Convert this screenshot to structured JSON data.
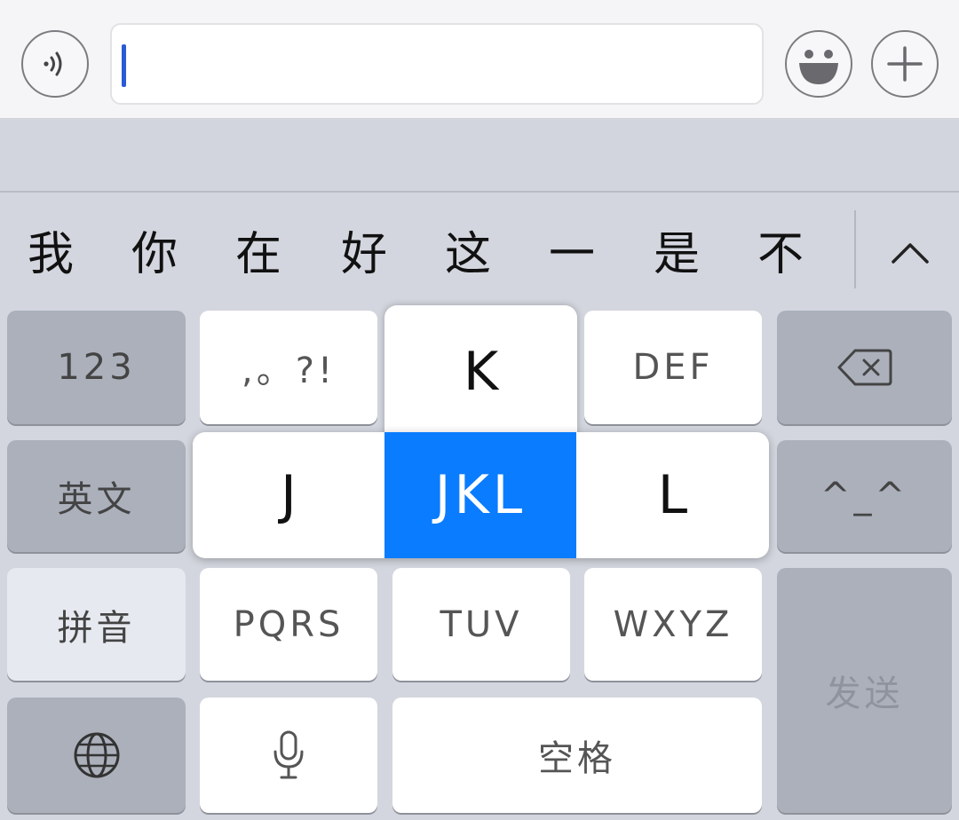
{
  "input_bar": {
    "voice_icon": "voice-wave-icon",
    "text_value": "",
    "emoji_icon": "emoji-smile-icon",
    "plus_icon": "plus-icon"
  },
  "candidates": {
    "items": [
      "我",
      "你",
      "在",
      "好",
      "这",
      "一",
      "是",
      "不"
    ],
    "expand_icon": "chevron-up-icon"
  },
  "keyboard": {
    "numbers_label": "123",
    "english_label": "英文",
    "pinyin_label": "拼音",
    "globe_icon": "globe-icon",
    "punct_label": ",。?!",
    "def_label": "DEF",
    "pqrs_label": "PQRS",
    "tuv_label": "TUV",
    "wxyz_label": "WXYZ",
    "mic_icon": "microphone-icon",
    "space_label": "空格",
    "backspace_icon": "backspace-icon",
    "emoticon_label": "^_^",
    "send_label": "发送"
  },
  "popup": {
    "top_label": "K",
    "left_label": "J",
    "selected_label": "JKL",
    "right_label": "L",
    "selected_color": "#0a7cff"
  }
}
